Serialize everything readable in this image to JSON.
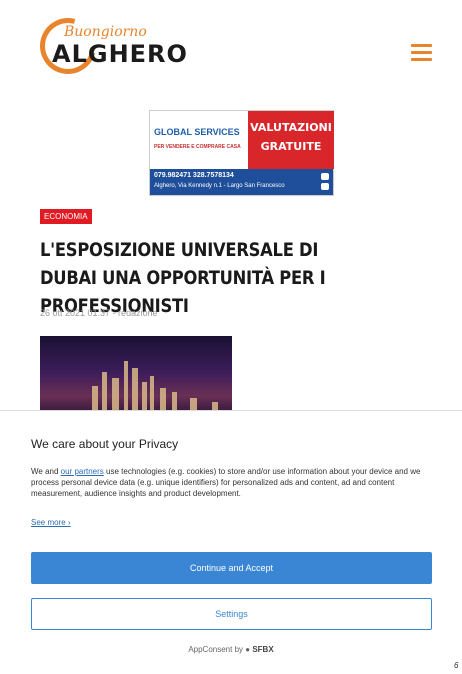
{
  "header": {
    "logo_script": "Buongiorno",
    "logo_brand": "ALGHERO",
    "menu_icon": "hamburger-icon"
  },
  "ad": {
    "company": "GLOBAL SERVICES",
    "tagline": "PER VENDERE E COMPRARE CASA",
    "headline_1": "VALUTAZIONI",
    "headline_2": "GRATUITE",
    "phones": "079.982471   328.7578134",
    "address": "Alghero, Via Kennedy n.1 - Largo San Francesco",
    "colors": {
      "red": "#d8262a",
      "blue": "#1f4f9a"
    }
  },
  "article": {
    "category": "ECONOMIA",
    "title": "L'ESPOSIZIONE UNIVERSALE DI DUBAI UNA OPPORTUNITÀ PER I PROFESSIONISTI",
    "meta": "26 ott 2021 01:37 - redazione"
  },
  "consent": {
    "title": "We care about your Privacy",
    "text_before_link": "We and ",
    "link_text": "our partners",
    "text_after_link": " use technologies (e.g. cookies) to store and/or use information about your device and we process personal device data (e.g. unique identifiers) for personalized ads and content, ad and content measurement, audience insights and product development.",
    "see_more": "See more",
    "accept_label": "Continue and Accept",
    "settings_label": "Settings",
    "powered_prefix": "AppConsent by",
    "powered_brand": "SFBX",
    "accent_color": "#3a86d4"
  },
  "corner_mark": "6"
}
